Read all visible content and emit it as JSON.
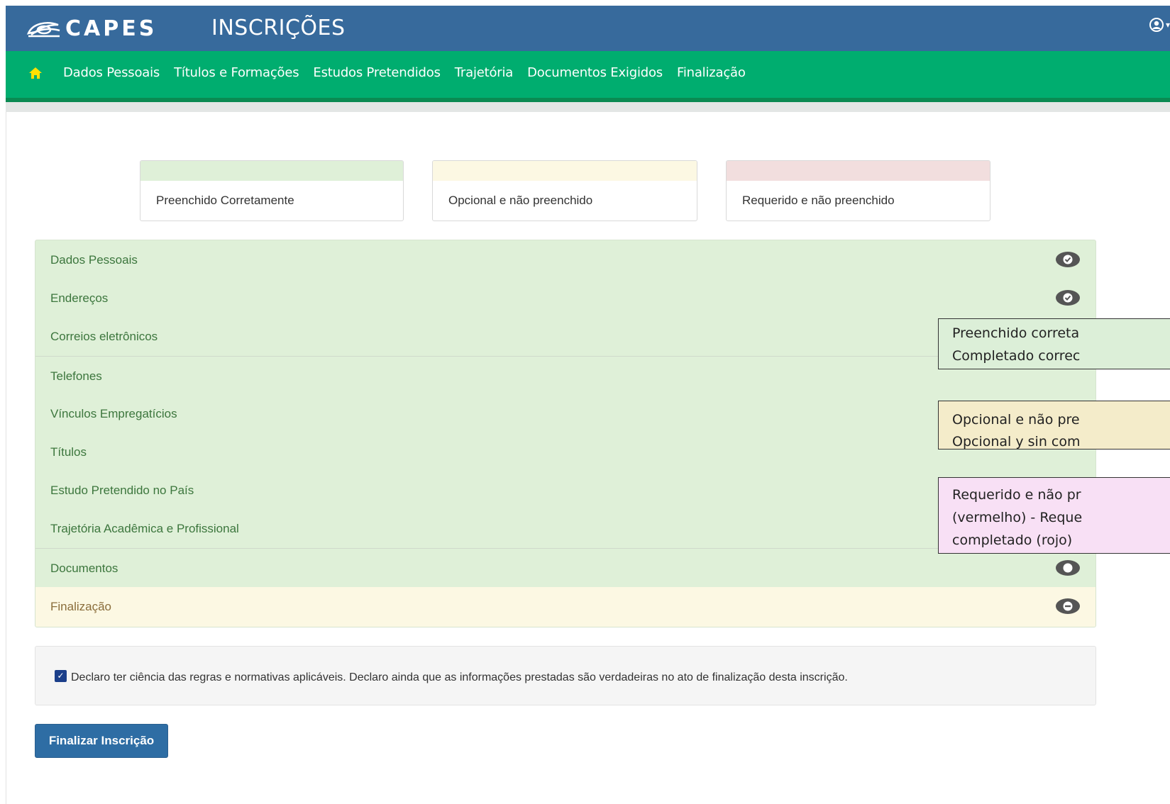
{
  "header": {
    "logo_text": "CAPES",
    "app_title": "INSCRIÇÕES",
    "user_icon": "user-circle-icon"
  },
  "nav": {
    "home_icon": "home-icon",
    "items": [
      "Dados Pessoais",
      "Títulos e Formações",
      "Estudos Pretendidos",
      "Trajetória",
      "Documentos Exigidos",
      "Finalização"
    ]
  },
  "legend": {
    "items": [
      {
        "label": "Preenchido Corretamente",
        "color": "#dff0d8"
      },
      {
        "label": "Opcional e não preenchido",
        "color": "#fcf8e3"
      },
      {
        "label": "Requerido e não preenchido",
        "color": "#f2dede"
      }
    ]
  },
  "sections": [
    {
      "label": "Dados Pessoais",
      "status": "ok"
    },
    {
      "label": "Endereços",
      "status": "ok"
    },
    {
      "label": "Correios eletrônicos",
      "status": "ok"
    },
    {
      "label": "Telefones",
      "status": "ok"
    },
    {
      "label": "Vínculos Empregatícios",
      "status": "ok"
    },
    {
      "label": "Títulos",
      "status": "ok"
    },
    {
      "label": "Estudo Pretendido no País",
      "status": "ok"
    },
    {
      "label": "Trajetória Acadêmica e Profissional",
      "status": "ok"
    },
    {
      "label": "Documentos",
      "status": "ok"
    },
    {
      "label": "Finalização",
      "status": "optional"
    }
  ],
  "declaration": {
    "checked": true,
    "text": "Declaro ter ciência das regras e normativas aplicáveis. Declaro ainda que as informações prestadas são verdadeiras no ato de finalização desta inscrição."
  },
  "finalize_button": "Finalizar Inscrição",
  "callouts": [
    {
      "lines": [
        "Preenchido correta",
        "Completado correc"
      ],
      "color": "#dcefd8"
    },
    {
      "lines": [
        "Opcional e não pre",
        "Opcional y sin com"
      ],
      "color": "#f4ecca"
    },
    {
      "lines": [
        "Requerido e não pr",
        "(vermelho) - Reque",
        "completado (rojo)"
      ],
      "color": "#f8e0f5"
    }
  ]
}
